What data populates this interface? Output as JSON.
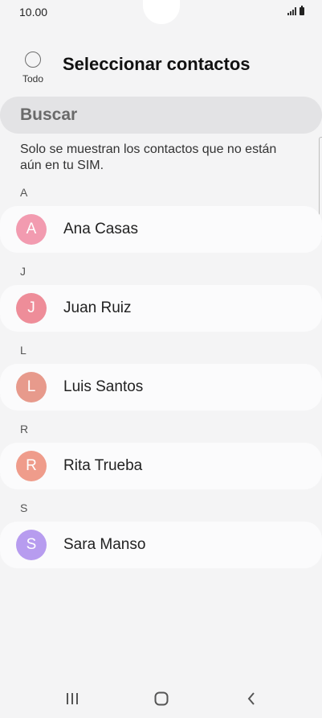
{
  "status_bar": {
    "time": "10.00"
  },
  "header": {
    "select_all_label": "Todo",
    "title": "Seleccionar contactos"
  },
  "search": {
    "placeholder": "Buscar"
  },
  "info": {
    "text": "Solo se muestran los contactos que no están aún en tu SIM."
  },
  "sections": [
    {
      "letter": "A",
      "contacts": [
        {
          "initial": "A",
          "name": "Ana Casas",
          "color": "#f29bb0"
        }
      ]
    },
    {
      "letter": "J",
      "contacts": [
        {
          "initial": "J",
          "name": "Juan Ruiz",
          "color": "#ee8d99"
        }
      ]
    },
    {
      "letter": "L",
      "contacts": [
        {
          "initial": "L",
          "name": "Luis Santos",
          "color": "#e79a8c"
        }
      ]
    },
    {
      "letter": "R",
      "contacts": [
        {
          "initial": "R",
          "name": "Rita Trueba",
          "color": "#ef9c8b"
        }
      ]
    },
    {
      "letter": "S",
      "contacts": [
        {
          "initial": "S",
          "name": "Sara Manso",
          "color": "#b79cef"
        }
      ]
    }
  ],
  "nav": {
    "icons": [
      "recent-apps-icon",
      "home-icon",
      "back-icon"
    ]
  }
}
